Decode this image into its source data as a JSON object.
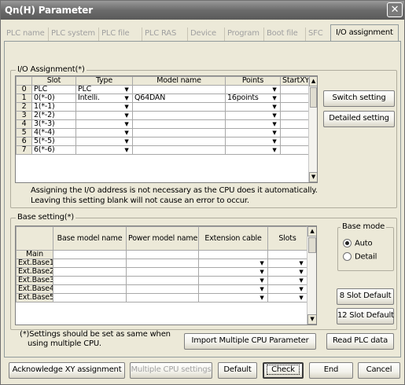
{
  "window": {
    "title": "Qn(H) Parameter",
    "close_glyph": "✕"
  },
  "tabs": [
    "PLC name",
    "PLC system",
    "PLC file",
    "PLC RAS",
    "Device",
    "Program",
    "Boot file",
    "SFC",
    "I/O assignment"
  ],
  "active_tab": "I/O assignment",
  "io_assignment": {
    "label": "I/O Assignment(*)",
    "columns": [
      "",
      "Slot",
      "Type",
      "Model name",
      "Points",
      "StartXY"
    ],
    "rows": [
      {
        "idx": "0",
        "slot": "PLC",
        "type": "PLC",
        "model": "",
        "points": "",
        "start": ""
      },
      {
        "idx": "1",
        "slot": "0(*-0)",
        "type": "Intelli.",
        "model": "Q64DAN",
        "points": "16points",
        "start": ""
      },
      {
        "idx": "2",
        "slot": "1(*-1)",
        "type": "",
        "model": "",
        "points": "",
        "start": ""
      },
      {
        "idx": "3",
        "slot": "2(*-2)",
        "type": "",
        "model": "",
        "points": "",
        "start": ""
      },
      {
        "idx": "4",
        "slot": "3(*-3)",
        "type": "",
        "model": "",
        "points": "",
        "start": ""
      },
      {
        "idx": "5",
        "slot": "4(*-4)",
        "type": "",
        "model": "",
        "points": "",
        "start": ""
      },
      {
        "idx": "6",
        "slot": "5(*-5)",
        "type": "",
        "model": "",
        "points": "",
        "start": ""
      },
      {
        "idx": "7",
        "slot": "6(*-6)",
        "type": "",
        "model": "",
        "points": "",
        "start": ""
      }
    ],
    "switch_setting": "Switch setting",
    "detailed_setting": "Detailed setting",
    "note_line1": "Assigning the I/O address is not necessary as the CPU does it automatically.",
    "note_line2": "Leaving this setting blank will not cause an error to occur."
  },
  "base_setting": {
    "label": "Base setting(*)",
    "columns": [
      "",
      "Base model name",
      "Power model name",
      "Extension cable",
      "Slots"
    ],
    "rows": [
      "Main",
      "Ext.Base1",
      "Ext.Base2",
      "Ext.Base3",
      "Ext.Base4",
      "Ext.Base5"
    ],
    "base_mode_label": "Base mode",
    "auto_label": "Auto",
    "detail_label": "Detail",
    "base_mode_selected": "Auto",
    "slot8_default": "8 Slot Default",
    "slot12_default": "12 Slot Default"
  },
  "footer_note": {
    "line1": "(*)Settings should be set as same when",
    "line2": "using multiple CPU."
  },
  "import_button": "Import Multiple CPU Parameter",
  "read_plc_button": "Read PLC data",
  "bottom_buttons": {
    "acknowledge": "Acknowledge XY assignment",
    "multiple_cpu": "Multiple CPU settings",
    "default": "Default",
    "check": "Check",
    "end": "End",
    "cancel": "Cancel"
  }
}
